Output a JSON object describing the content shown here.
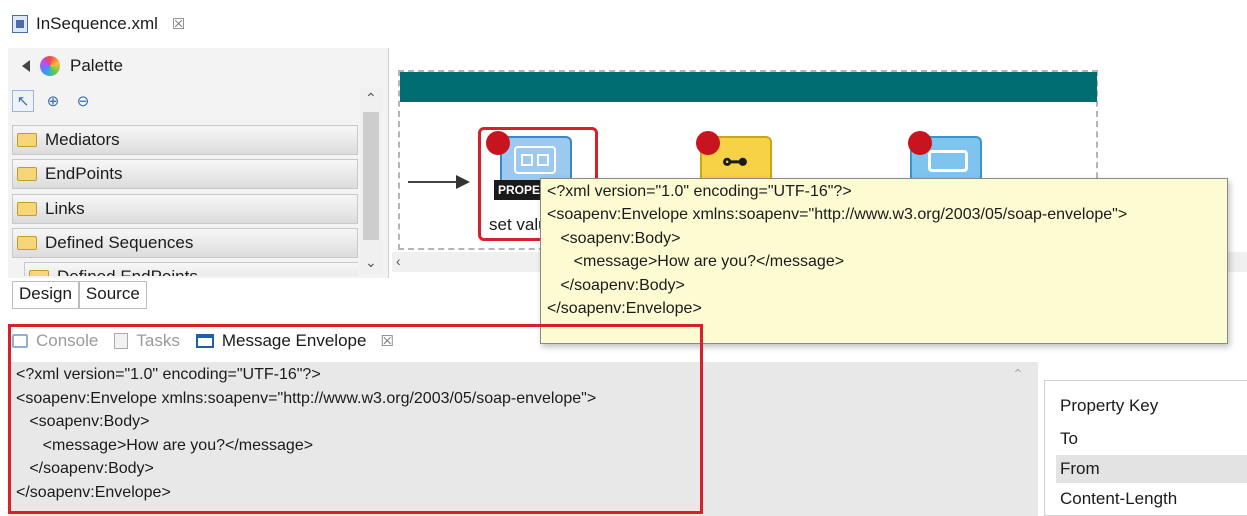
{
  "editor": {
    "tab_label": "InSequence.xml"
  },
  "palette": {
    "title": "Palette",
    "drawers": [
      "Mediators",
      "EndPoints",
      "Links",
      "Defined Sequences",
      "Defined EndPoints"
    ]
  },
  "editor_tabs": [
    "Design",
    "Source"
  ],
  "canvas": {
    "mediators": [
      {
        "icon": "property-mediator-icon",
        "caption": "PROPERTY",
        "label": "set value"
      },
      {
        "icon": "enrich-mediator-icon"
      },
      {
        "icon": "send-mediator-icon"
      }
    ]
  },
  "tooltip": {
    "lines": [
      "<?xml version=\"1.0\" encoding=\"UTF-16\"?>",
      "<soapenv:Envelope xmlns:soapenv=\"http://www.w3.org/2003/05/soap-envelope\">",
      "   <soapenv:Body>",
      "      <message>How are you?</message>",
      "   </soapenv:Body>",
      "</soapenv:Envelope>"
    ]
  },
  "views": {
    "tabs": [
      "Console",
      "Tasks",
      "Message Envelope"
    ],
    "envelope_lines": [
      "<?xml version=\"1.0\" encoding=\"UTF-16\"?>",
      "<soapenv:Envelope xmlns:soapenv=\"http://www.w3.org/2003/05/soap-envelope\">",
      "   <soapenv:Body>",
      "      <message>How are you?</message>",
      "   </soapenv:Body>",
      "</soapenv:Envelope>"
    ]
  },
  "properties": {
    "header": "Property Key",
    "rows": [
      "To",
      "From",
      "Content-Length"
    ]
  },
  "colors": {
    "accent_bar": "#006d72",
    "highlight_red": "#d6202a",
    "tooltip_bg": "#fdfbd2"
  }
}
